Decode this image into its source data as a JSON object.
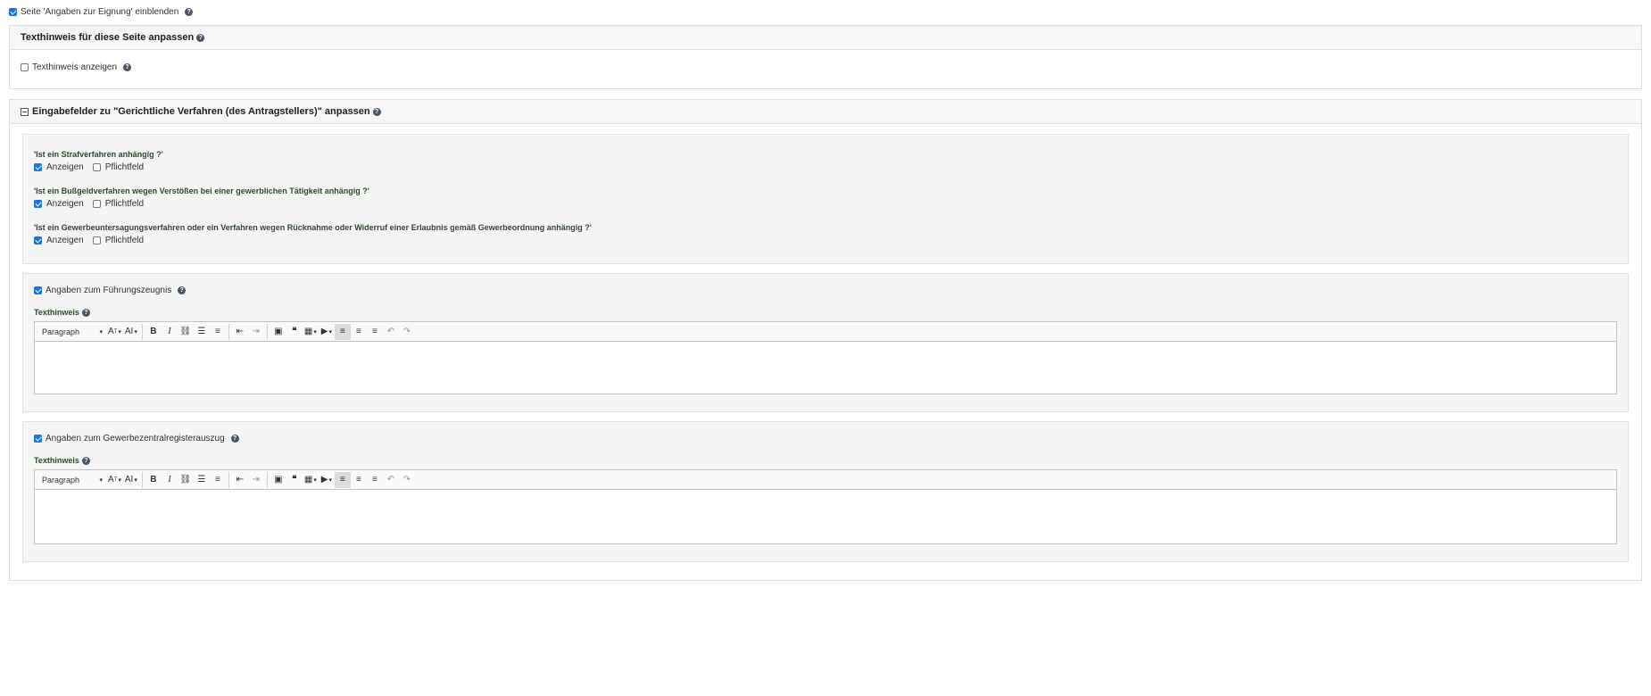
{
  "top": {
    "label": "Seite 'Angaben zur Eignung' einblenden"
  },
  "hint_panel": {
    "title": "Texthinweis für diese Seite anpassen",
    "show_label": "Texthinweis anzeigen"
  },
  "fields_panel": {
    "title": "Eingabefelder zu \"Gerichtliche Verfahren (des Antragstellers)\" anpassen",
    "questions": [
      {
        "label": "'Ist ein Strafverfahren anhängig ?'",
        "show": "Anzeigen",
        "required": "Pflichtfeld"
      },
      {
        "label": "'Ist ein Bußgeldverfahren wegen Verstößen bei einer gewerblichen Tätigkeit anhängig ?'",
        "show": "Anzeigen",
        "required": "Pflichtfeld"
      },
      {
        "label": "'Ist ein Gewerbeuntersagungsverfahren oder ein Verfahren wegen Rücknahme oder Widerruf einer Erlaubnis gemäß Gewerbeordnung anhängig ?'",
        "show": "Anzeigen",
        "required": "Pflichtfeld"
      }
    ]
  },
  "sections": [
    {
      "checkbox_label": "Angaben zum Führungszeugnis",
      "field_label": "Texthinweis",
      "paragraph": "Paragraph"
    },
    {
      "checkbox_label": "Angaben zum Gewerbezentralregisterauszug",
      "field_label": "Texthinweis",
      "paragraph": "Paragraph"
    }
  ],
  "colors": {
    "accent": "#1a73e8",
    "panel_head": "#f6f6f6",
    "well": "#f5f5f5"
  }
}
